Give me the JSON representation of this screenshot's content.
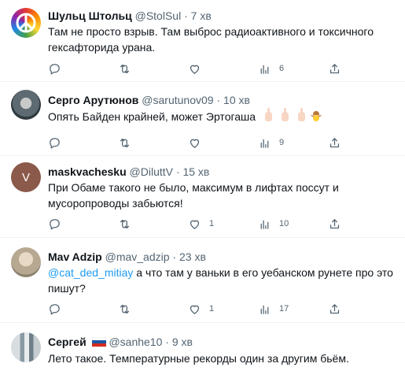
{
  "tweets": [
    {
      "name": "Шульц Штольц",
      "handle": "@StolSul",
      "time": "7 хв",
      "text": "Там не просто взрыв. Там выброс радиоактивного и токсичного гексафторида урана.",
      "likes": "6",
      "avatar": "peace-icon"
    },
    {
      "name": "Серго Арутюнов",
      "handle": "@sarutunov09",
      "time": "10 хв",
      "text": "Опять Байден крайней, может Эртогаша",
      "likes": "9",
      "avatar": "photo"
    },
    {
      "name": "maskvachesku",
      "handle": "@DiluttV",
      "time": "15 хв",
      "text": "При Обаме такого не было, максимум в лифтах поссут и мусоропроводы забьются!",
      "replies": "1",
      "likes": "10",
      "avatar_letter": "V",
      "avatar_color": "#8b5a4a"
    },
    {
      "name": "Mav Adzip",
      "handle": "@mav_adzip",
      "time": "23 хв",
      "mention": "@cat_ded_mitiay",
      "text": " а что там у ваньки в его уебанском рунете про это пишут?",
      "replies": "1",
      "likes": "17",
      "avatar": "photo"
    },
    {
      "name": "Сергей",
      "handle": "@sanhe10",
      "time": "9 хв",
      "text": "Лето такое. Температурные рекорды один за другим бьём.",
      "avatar": "photo"
    }
  ],
  "separator": "·"
}
